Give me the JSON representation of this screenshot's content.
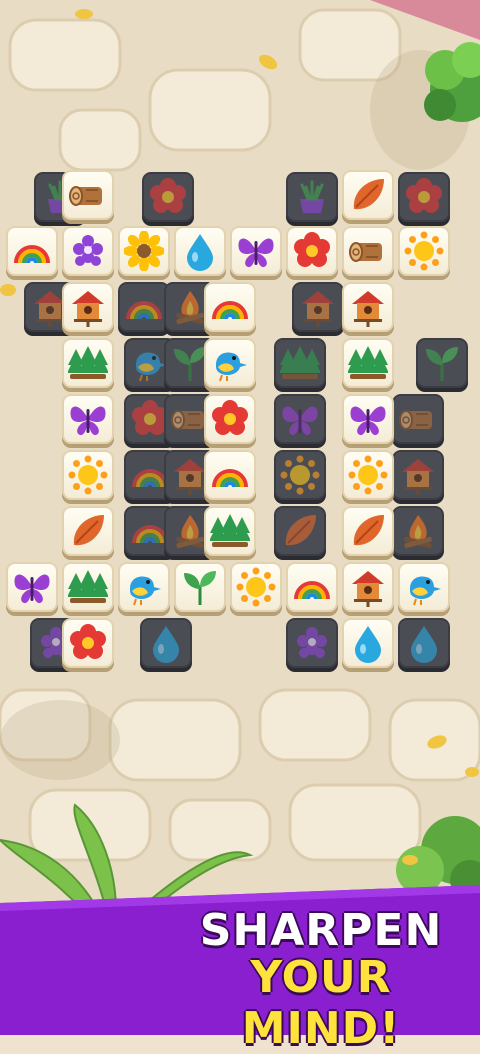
{
  "banner": {
    "line1": "SHARPEN",
    "line2": "YOUR MIND!",
    "colors": {
      "band": "#8a1fd0",
      "line1": "#ffffff",
      "line2": "#ffe23c"
    }
  },
  "board": {
    "background_layer": [
      {
        "icon": "grass-pot",
        "state": "blocked"
      },
      {
        "icon": "flower",
        "state": "blocked"
      },
      {
        "icon": "grass-pot",
        "state": "blocked"
      },
      {
        "icon": "flower",
        "state": "blocked"
      },
      {
        "icon": "birdhouse",
        "state": "blocked"
      },
      {
        "icon": "rainbow",
        "state": "blocked"
      },
      {
        "icon": "campfire",
        "state": "blocked"
      },
      {
        "icon": "birdhouse",
        "state": "blocked"
      },
      {
        "icon": "bird",
        "state": "blocked"
      },
      {
        "icon": "sprout",
        "state": "blocked"
      },
      {
        "icon": "trees",
        "state": "blocked"
      },
      {
        "icon": "sprout",
        "state": "blocked"
      },
      {
        "icon": "flower",
        "state": "blocked"
      },
      {
        "icon": "log",
        "state": "blocked"
      },
      {
        "icon": "butterfly",
        "state": "blocked"
      },
      {
        "icon": "log",
        "state": "blocked"
      },
      {
        "icon": "rainbow",
        "state": "blocked"
      },
      {
        "icon": "birdhouse",
        "state": "blocked"
      },
      {
        "icon": "sun",
        "state": "blocked"
      },
      {
        "icon": "birdhouse",
        "state": "blocked"
      },
      {
        "icon": "rainbow",
        "state": "blocked"
      },
      {
        "icon": "campfire",
        "state": "blocked"
      },
      {
        "icon": "leaf",
        "state": "blocked"
      },
      {
        "icon": "campfire",
        "state": "blocked"
      },
      {
        "icon": "grapes",
        "state": "blocked"
      },
      {
        "icon": "water-drop",
        "state": "blocked"
      },
      {
        "icon": "grapes",
        "state": "blocked"
      },
      {
        "icon": "water-drop",
        "state": "blocked"
      }
    ],
    "open_tiles": [
      {
        "icon": "log",
        "state": "open"
      },
      {
        "icon": "leaf",
        "state": "open"
      },
      {
        "icon": "rainbow",
        "state": "open"
      },
      {
        "icon": "grapes",
        "state": "open"
      },
      {
        "icon": "sunflower",
        "state": "open"
      },
      {
        "icon": "water-drop",
        "state": "open"
      },
      {
        "icon": "butterfly",
        "state": "open"
      },
      {
        "icon": "flower",
        "state": "open"
      },
      {
        "icon": "log",
        "state": "open"
      },
      {
        "icon": "sun",
        "state": "open"
      },
      {
        "icon": "birdhouse",
        "state": "open"
      },
      {
        "icon": "rainbow",
        "state": "open"
      },
      {
        "icon": "birdhouse",
        "state": "open"
      },
      {
        "icon": "trees",
        "state": "open"
      },
      {
        "icon": "bird",
        "state": "open"
      },
      {
        "icon": "trees",
        "state": "open"
      },
      {
        "icon": "butterfly",
        "state": "open"
      },
      {
        "icon": "flower",
        "state": "open"
      },
      {
        "icon": "butterfly",
        "state": "open"
      },
      {
        "icon": "sun",
        "state": "open"
      },
      {
        "icon": "rainbow",
        "state": "open"
      },
      {
        "icon": "sun",
        "state": "open"
      },
      {
        "icon": "leaf",
        "state": "open"
      },
      {
        "icon": "trees",
        "state": "open"
      },
      {
        "icon": "leaf",
        "state": "open"
      },
      {
        "icon": "butterfly",
        "state": "open"
      },
      {
        "icon": "trees",
        "state": "open"
      },
      {
        "icon": "bird",
        "state": "open"
      },
      {
        "icon": "sprout",
        "state": "open"
      },
      {
        "icon": "sun",
        "state": "open"
      },
      {
        "icon": "rainbow",
        "state": "open"
      },
      {
        "icon": "birdhouse",
        "state": "open"
      },
      {
        "icon": "bird",
        "state": "open"
      },
      {
        "icon": "flower",
        "state": "open"
      },
      {
        "icon": "water-drop",
        "state": "open"
      }
    ]
  }
}
